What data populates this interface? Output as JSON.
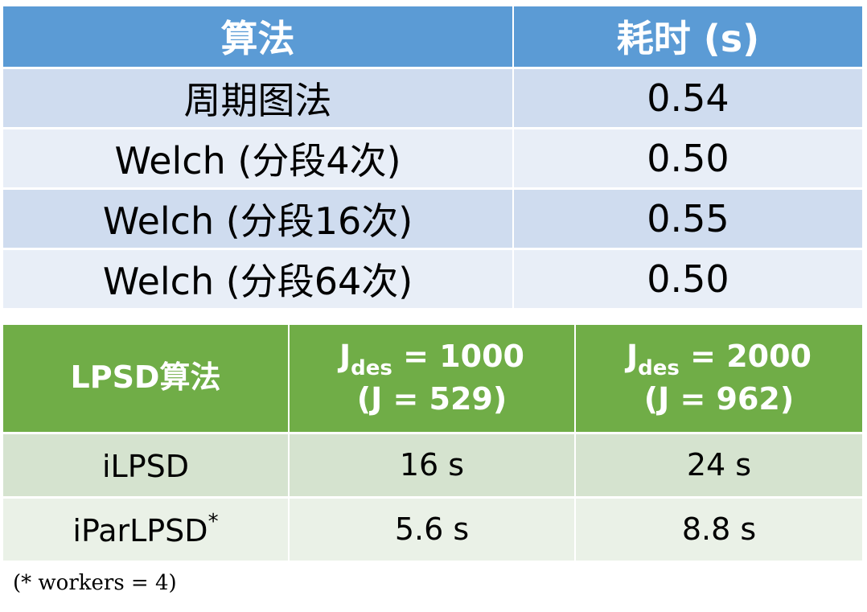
{
  "table1": {
    "headers": [
      "算法",
      "耗时 (s)"
    ],
    "rows": [
      [
        "周期图法",
        "0.54"
      ],
      [
        "Welch (分段4次)",
        "0.50"
      ],
      [
        "Welch (分段16次)",
        "0.55"
      ],
      [
        "Welch (分段64次)",
        "0.50"
      ]
    ],
    "colors": {
      "header": "#5b9bd5",
      "row_dark": "#cfdcef",
      "row_light": "#e8eef7"
    }
  },
  "table2": {
    "headers": {
      "col0": "LPSD算法",
      "col1": {
        "j": "J",
        "sub": "des",
        "eq": " = 1000",
        "line2": "(J = 529)"
      },
      "col2": {
        "j": "J",
        "sub": "des",
        "eq": " = 2000",
        "line2": "(J = 962)"
      }
    },
    "rows": [
      {
        "name": "iLPSD",
        "mark": "",
        "v1": "16 s",
        "v2": "24 s"
      },
      {
        "name": "iParLPSD",
        "mark": "*",
        "v1": "5.6 s",
        "v2": "8.8 s"
      }
    ],
    "colors": {
      "header": "#70ad47",
      "row_dark": "#d5e3cf",
      "row_light": "#eaf1e7"
    }
  },
  "footnote": "(* workers = 4)"
}
